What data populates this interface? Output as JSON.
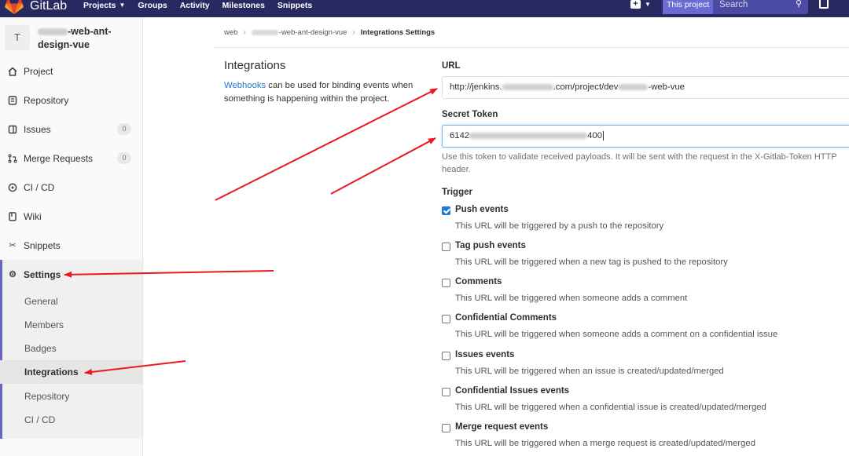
{
  "topbar": {
    "brand": "GitLab",
    "nav": [
      {
        "label": "Projects",
        "has_dropdown": true
      },
      {
        "label": "Groups",
        "has_dropdown": false
      },
      {
        "label": "Activity",
        "has_dropdown": false
      },
      {
        "label": "Milestones",
        "has_dropdown": false
      },
      {
        "label": "Snippets",
        "has_dropdown": false
      }
    ],
    "search_scope": "This project",
    "search_placeholder": "Search",
    "colors": {
      "bar": "#292961",
      "search": "#4b4ba3"
    }
  },
  "sidebar": {
    "avatar_letter": "T",
    "project_name_line1": "-web-ant-",
    "project_name_line2": "design-vue",
    "items": [
      {
        "label": "Project",
        "icon": "home-icon"
      },
      {
        "label": "Repository",
        "icon": "book-icon"
      },
      {
        "label": "Issues",
        "icon": "issues-icon",
        "badge": "0"
      },
      {
        "label": "Merge Requests",
        "icon": "merge-request-icon",
        "badge": "0"
      },
      {
        "label": "CI / CD",
        "icon": "rocket-icon"
      },
      {
        "label": "Wiki",
        "icon": "book-open-icon"
      },
      {
        "label": "Snippets",
        "icon": "scissors-icon"
      },
      {
        "label": "Settings",
        "icon": "gear-icon"
      }
    ],
    "settings_sub": [
      "General",
      "Members",
      "Badges",
      "Integrations",
      "Repository",
      "CI / CD"
    ],
    "active_sub": "Integrations",
    "accent": "#6666c4"
  },
  "breadcrumb": {
    "group": "web",
    "project_suffix": "-web-ant-design-vue",
    "current": "Integrations Settings"
  },
  "intro": {
    "title": "Integrations",
    "link": "Webhooks",
    "text": " can be used for binding events when something is happening within the project."
  },
  "form": {
    "url_label": "URL",
    "url_prefix": "http://jenkins.",
    "url_mid": ".com/project/dev",
    "url_suffix": "-web-vue",
    "token_label": "Secret Token",
    "token_start": "6142",
    "token_end": "400",
    "token_help": "Use this token to validate received payloads. It will be sent with the request in the X-Gitlab-Token HTTP header.",
    "trigger_label": "Trigger",
    "triggers": [
      {
        "name": "Push events",
        "desc": "This URL will be triggered by a push to the repository",
        "checked": true
      },
      {
        "name": "Tag push events",
        "desc": "This URL will be triggered when a new tag is pushed to the repository",
        "checked": false
      },
      {
        "name": "Comments",
        "desc": "This URL will be triggered when someone adds a comment",
        "checked": false
      },
      {
        "name": "Confidential Comments",
        "desc": "This URL will be triggered when someone adds a comment on a confidential issue",
        "checked": false
      },
      {
        "name": "Issues events",
        "desc": "This URL will be triggered when an issue is created/updated/merged",
        "checked": false
      },
      {
        "name": "Confidential Issues events",
        "desc": "This URL will be triggered when a confidential issue is created/updated/merged",
        "checked": false
      },
      {
        "name": "Merge request events",
        "desc": "This URL will be triggered when a merge request is created/updated/merged",
        "checked": false
      }
    ]
  },
  "annotations": {
    "arrow_color": "#e8191f"
  }
}
